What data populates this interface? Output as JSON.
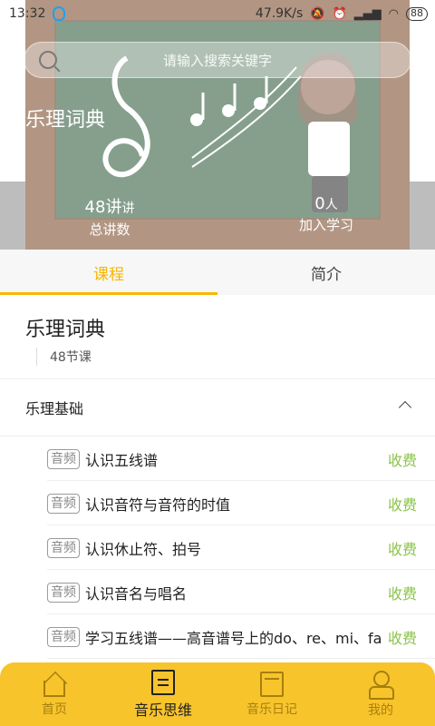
{
  "status_bar": {
    "time": "13:32",
    "network_speed": "47.9K/s",
    "battery": "88",
    "icons": [
      "qq-icon",
      "mute-icon",
      "alarm-icon",
      "signal-icon",
      "wifi-icon",
      "battery-icon"
    ]
  },
  "hero": {
    "search_placeholder": "请输入搜索关键字",
    "title": "乐理词典",
    "stats": [
      {
        "value": "48讲",
        "unit": "讲",
        "label": "总讲数"
      },
      {
        "value": "0",
        "unit": "人",
        "label": "加入学习"
      }
    ]
  },
  "tabs": [
    "课程",
    "简介"
  ],
  "course": {
    "title": "乐理词典",
    "lesson_count": "48节课"
  },
  "section": {
    "title": "乐理基础"
  },
  "lessons": [
    {
      "badge": "音频",
      "title": "认识五线谱",
      "price": "收费"
    },
    {
      "badge": "音频",
      "title": "认识音符与音符的时值",
      "price": "收费"
    },
    {
      "badge": "音频",
      "title": "认识休止符、拍号",
      "price": "收费"
    },
    {
      "badge": "音频",
      "title": "认识音名与唱名",
      "price": "收费"
    },
    {
      "badge": "音频",
      "title": "学习五线谱——高音谱号上的do、re、mi、fa",
      "price": "收费"
    }
  ],
  "bottom_nav": [
    {
      "label": "首页",
      "icon": "home-icon"
    },
    {
      "label": "音乐思维",
      "icon": "book-icon"
    },
    {
      "label": "音乐日记",
      "icon": "diary-icon"
    },
    {
      "label": "我的",
      "icon": "user-icon"
    }
  ],
  "colors": {
    "accent": "#f7b600",
    "price": "#8bc34a",
    "nav_bg": "#f8c42c"
  }
}
